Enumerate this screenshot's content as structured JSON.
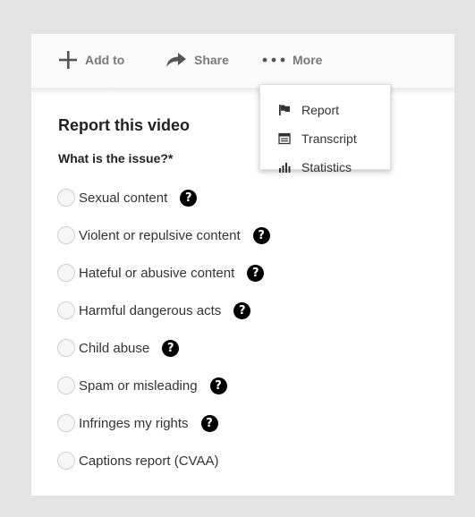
{
  "toolbar": {
    "add_label": "Add to",
    "share_label": "Share",
    "more_label": "More"
  },
  "more_menu": {
    "items": [
      {
        "label": "Report",
        "icon": "flag-icon"
      },
      {
        "label": "Transcript",
        "icon": "transcript-icon"
      },
      {
        "label": "Statistics",
        "icon": "bar-chart-icon"
      }
    ]
  },
  "report": {
    "title": "Report this video",
    "question": "What is the issue?*",
    "options": [
      {
        "label": "Sexual content",
        "help": "?"
      },
      {
        "label": "Violent or repulsive content",
        "help": "?"
      },
      {
        "label": "Hateful or abusive content",
        "help": "?"
      },
      {
        "label": "Harmful dangerous acts",
        "help": "?"
      },
      {
        "label": "Child abuse",
        "help": "?"
      },
      {
        "label": "Spam or misleading",
        "help": "?"
      },
      {
        "label": "Infringes my rights",
        "help": "?"
      },
      {
        "label": "Captions report (CVAA)"
      }
    ]
  },
  "colors": {
    "background": "#e3e3e3",
    "card": "#ffffff",
    "toolbar_text": "#7a7a7a",
    "help_badge": "#000000"
  }
}
